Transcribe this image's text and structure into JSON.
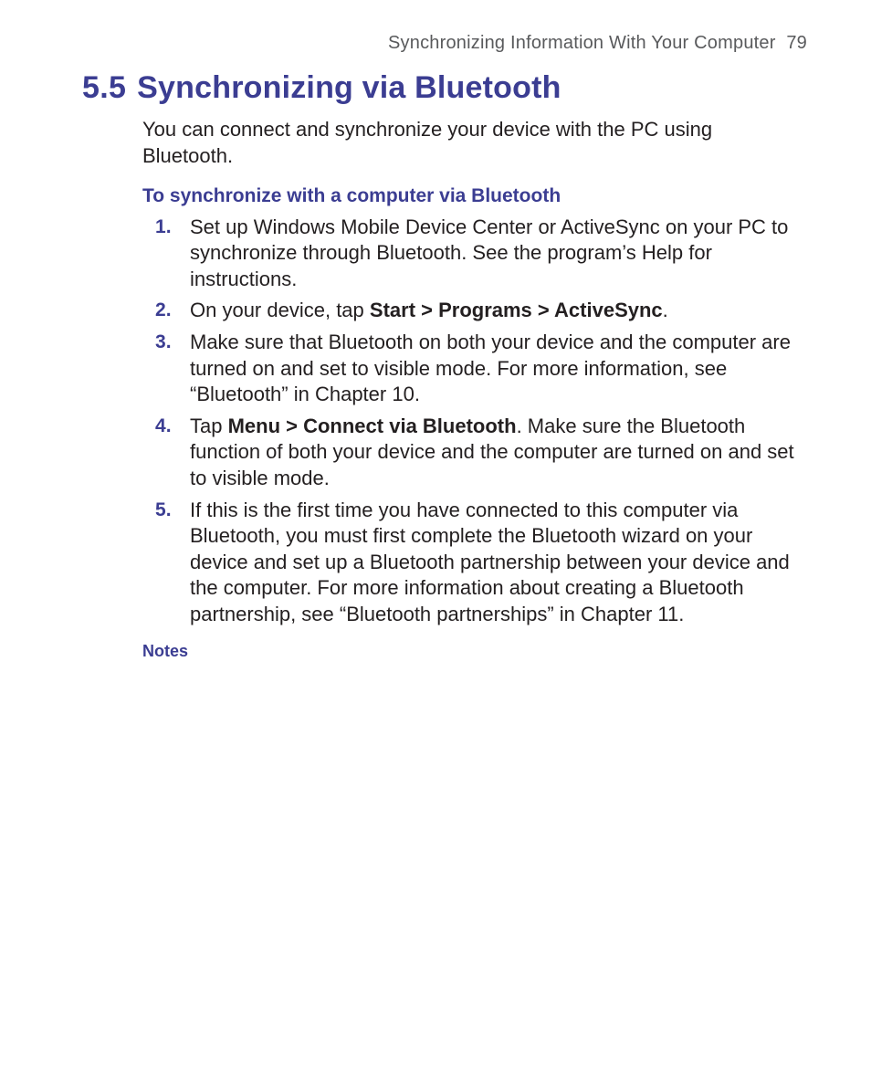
{
  "header": {
    "chapter_title": "Synchronizing Information With Your Computer",
    "page_number": "79"
  },
  "section": {
    "number": "5.5",
    "title": "Synchronizing via Bluetooth"
  },
  "intro": "You can connect and synchronize your device with the PC using Bluetooth.",
  "subheading": "To synchronize with a computer via Bluetooth",
  "steps": {
    "s1": "Set up Windows Mobile Device Center or ActiveSync on your PC to synchronize through Bluetooth. See the program’s Help for instructions.",
    "s2_pre": "On your device, tap ",
    "s2_bold": "Start > Programs > ActiveSync",
    "s2_post": ".",
    "s3": "Make sure that Bluetooth on both your device and the computer are turned on and set to visible mode. For more information, see “Bluetooth” in Chapter 10.",
    "s4_pre": "Tap ",
    "s4_bold": "Menu > Connect via Bluetooth",
    "s4_post": ". Make sure the Bluetooth function of both your device and the computer are turned on and set to visible mode.",
    "s5": "If this is the first time you have connected to this computer via Bluetooth, you must first complete the Bluetooth wizard on your device and set up a Bluetooth partnership between your device and the computer. For more information about creating a Bluetooth partnership, see “Bluetooth partnerships” in Chapter 11."
  },
  "notes_label": "Notes"
}
